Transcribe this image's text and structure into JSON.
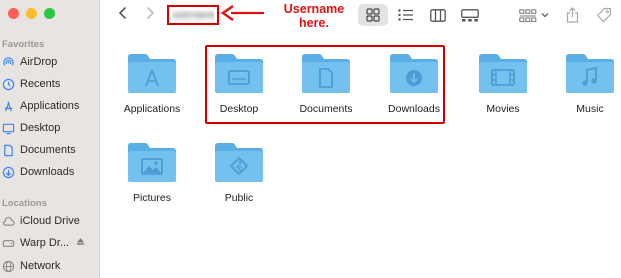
{
  "sidebar": {
    "favorites_title": "Favorites",
    "favorites": [
      {
        "label": "AirDrop",
        "icon": "airdrop-icon"
      },
      {
        "label": "Recents",
        "icon": "clock-icon"
      },
      {
        "label": "Applications",
        "icon": "applications-icon"
      },
      {
        "label": "Desktop",
        "icon": "desktop-icon"
      },
      {
        "label": "Documents",
        "icon": "document-icon"
      },
      {
        "label": "Downloads",
        "icon": "download-icon"
      }
    ],
    "locations_title": "Locations",
    "locations": [
      {
        "label": "iCloud Drive",
        "icon": "cloud-icon"
      },
      {
        "label": "Warp Dr...",
        "icon": "drive-icon"
      },
      {
        "label": "Network",
        "icon": "globe-icon"
      }
    ]
  },
  "toolbar": {
    "folder_title": "username",
    "annotation": "Username here."
  },
  "folders": [
    {
      "label": "Applications",
      "icon": "applications-folder-icon"
    },
    {
      "label": "Desktop",
      "icon": "desktop-folder-icon"
    },
    {
      "label": "Documents",
      "icon": "documents-folder-icon"
    },
    {
      "label": "Downloads",
      "icon": "downloads-folder-icon"
    },
    {
      "label": "Movies",
      "icon": "movies-folder-icon"
    },
    {
      "label": "Music",
      "icon": "music-folder-icon"
    },
    {
      "label": "Pictures",
      "icon": "pictures-folder-icon"
    },
    {
      "label": "Public",
      "icon": "public-folder-icon"
    }
  ],
  "colors": {
    "accent": "#3f86f2",
    "annotation": "#d40000",
    "folder": "#74c0ef",
    "folder_tab": "#5aafe6",
    "traffic_close": "#fe5f57",
    "traffic_min": "#febc2e",
    "traffic_max": "#28c840"
  }
}
